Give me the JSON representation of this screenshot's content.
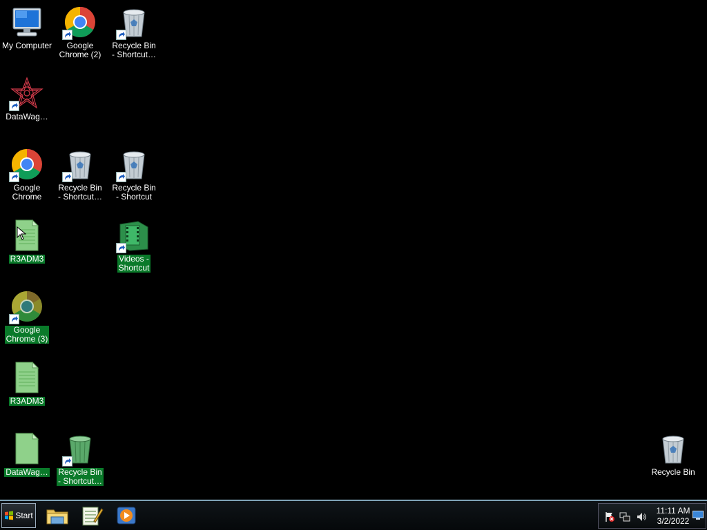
{
  "desktop": {
    "icons": {
      "my_computer": "My Computer",
      "chrome2": "Google\nChrome (2)",
      "rb_shortcut_top": "Recycle Bin\n- Shortcut…",
      "datawag1": "DataWag…",
      "chrome": "Google\nChrome",
      "rb_shortcut_mid": "Recycle Bin\n- Shortcut…",
      "rb_shortcut_right": "Recycle Bin\n- Shortcut",
      "r3adm3_a": "R3ADM3",
      "videos": "Videos -\nShortcut",
      "chrome3": "Google\nChrome (3)",
      "r3adm3_b": "R3ADM3",
      "datawag2": "DataWag…",
      "rb_shortcut_bottom": "Recycle Bin\n- Shortcut…",
      "recycle_bin": "Recycle Bin"
    },
    "selection_color": "#0a7a2a"
  },
  "taskbar": {
    "start_label": "Start",
    "pinned": [
      "file-explorer-icon",
      "notepad-icon",
      "media-player-icon"
    ],
    "tray": {
      "time": "11:11 AM",
      "date": "3/2/2022",
      "icons": [
        "action-center-flag-icon",
        "network-icon",
        "volume-icon",
        "show-desktop-icon"
      ]
    }
  }
}
